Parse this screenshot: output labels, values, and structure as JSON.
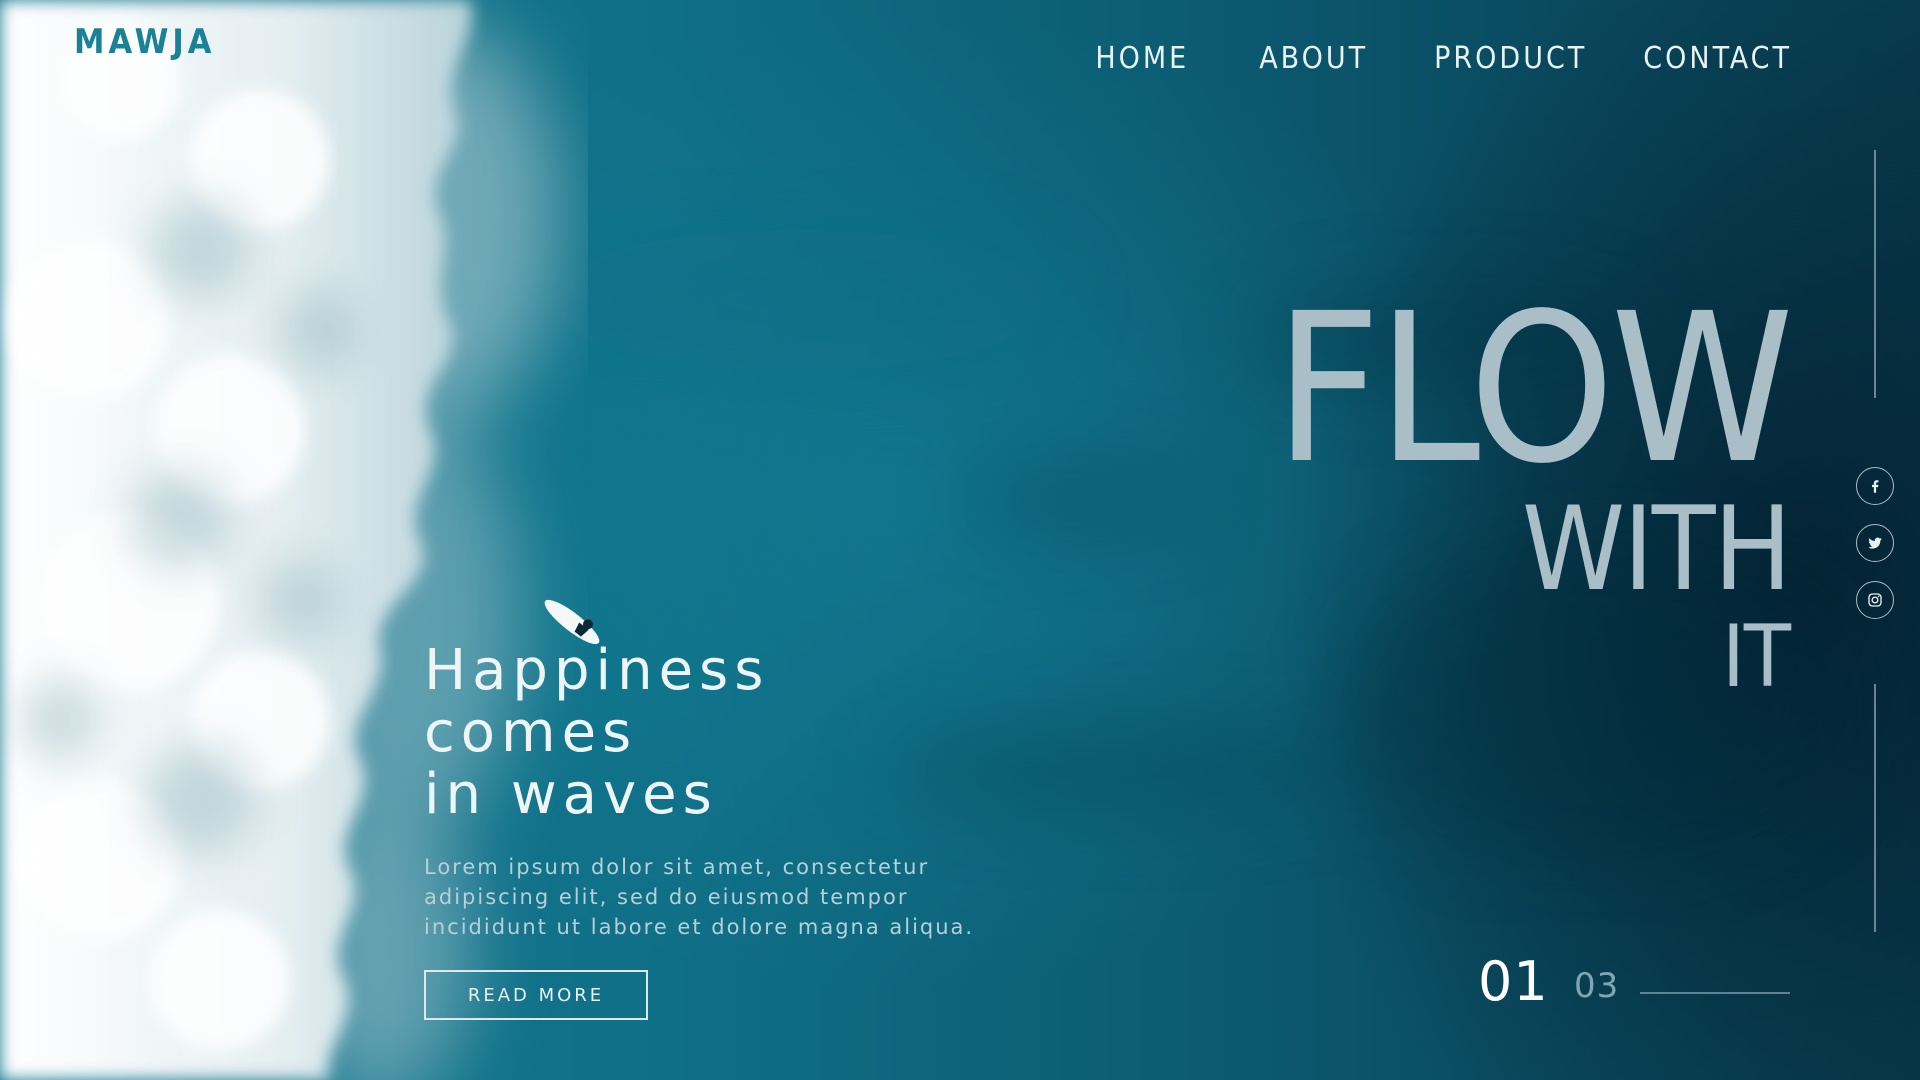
{
  "brand": {
    "logo": "MAWJA"
  },
  "nav": {
    "items": [
      "HOME",
      "ABOUT",
      "PRODUCT",
      "CONTACT"
    ]
  },
  "headline": {
    "line1": "FLOW",
    "line2": "WITH",
    "line3": "IT"
  },
  "tagline": {
    "line1": "Happiness",
    "line2": "comes",
    "line3": "in waves"
  },
  "body_text": {
    "line1": "Lorem ipsum dolor sit amet, consectetur",
    "line2": "adipiscing elit, sed do eiusmod tempor",
    "line3": "incididunt ut labore et dolore magna aliqua."
  },
  "cta": {
    "label": "READ MORE"
  },
  "slider": {
    "current": "01",
    "total": "03"
  },
  "social": {
    "icons": [
      "facebook-icon",
      "twitter-icon",
      "instagram-icon"
    ]
  },
  "colors": {
    "sea": "#0e6a80",
    "logo": "#1a8296",
    "headline": "#a9bec6",
    "text_light": "#eef5f7"
  }
}
